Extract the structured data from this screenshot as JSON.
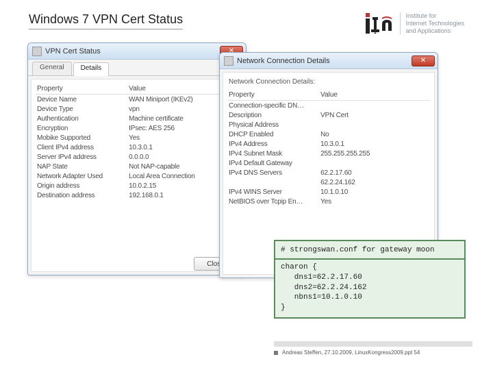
{
  "slide": {
    "title": "Windows 7 VPN Cert Status",
    "logo_lines": [
      "Institute for",
      "Internet Technologies",
      "and Applications"
    ]
  },
  "left_window": {
    "title": "VPN Cert Status",
    "tabs": {
      "general": "General",
      "details": "Details"
    },
    "headers": {
      "property": "Property",
      "value": "Value"
    },
    "rows": [
      {
        "p": "Device Name",
        "v": "WAN Miniport (IKEv2)"
      },
      {
        "p": "Device Type",
        "v": "vpn"
      },
      {
        "p": "Authentication",
        "v": "Machine certificate"
      },
      {
        "p": "Encryption",
        "v": "IPsec: AES 256"
      },
      {
        "p": "Mobike Supported",
        "v": "Yes"
      },
      {
        "p": "Client IPv4 address",
        "v": "10.3.0.1"
      },
      {
        "p": "Server IPv4 address",
        "v": "0.0.0.0"
      },
      {
        "p": "NAP State",
        "v": "Not NAP-capable"
      },
      {
        "p": "Network Adapter Used",
        "v": "Local Area Connection"
      },
      {
        "p": "Origin address",
        "v": "10.0.2.15"
      },
      {
        "p": "Destination address",
        "v": "192.168.0.1"
      }
    ],
    "close_btn": "Close"
  },
  "right_window": {
    "title": "Network Connection Details",
    "subtitle": "Network Connection Details:",
    "headers": {
      "property": "Property",
      "value": "Value"
    },
    "rows": [
      {
        "p": "Connection-specific DN…",
        "v": ""
      },
      {
        "p": "Description",
        "v": "VPN Cert"
      },
      {
        "p": "Physical Address",
        "v": ""
      },
      {
        "p": "DHCP Enabled",
        "v": "No"
      },
      {
        "p": "IPv4 Address",
        "v": "10.3.0.1"
      },
      {
        "p": "IPv4 Subnet Mask",
        "v": "255.255.255.255"
      },
      {
        "p": "IPv4 Default Gateway",
        "v": ""
      },
      {
        "p": "IPv4 DNS Servers",
        "v": "62.2.17.60"
      },
      {
        "p": "",
        "v": "62.2.24.162"
      },
      {
        "p": "IPv4 WINS Server",
        "v": "10.1.0.10"
      },
      {
        "p": "NetBIOS over Tcpip En…",
        "v": "Yes"
      }
    ]
  },
  "conf": {
    "header": "# strongswan.conf for gateway moon",
    "body": "charon {\n   dns1=62.2.17.60\n   dns2=62.2.24.162\n   nbns1=10.1.0.10\n}"
  },
  "footer": {
    "text": "Andreas Steffen, 27.10.2009, LinuxKongress2009.ppt 54"
  }
}
